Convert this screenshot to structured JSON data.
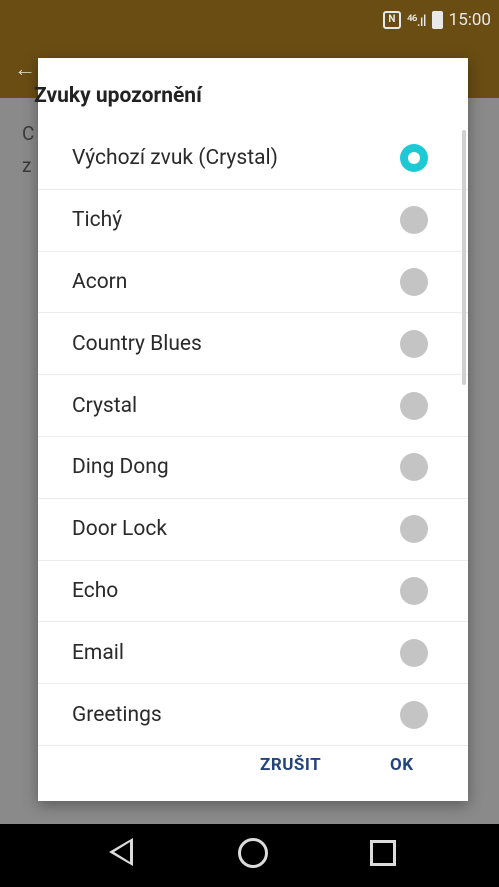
{
  "status_bar": {
    "nfc": "N",
    "signal": "⁴⁶.ıl",
    "time": "15:00"
  },
  "behind": {
    "line1": "C",
    "line2": "z"
  },
  "dialog": {
    "title": "Zvuky upozornění",
    "items": [
      {
        "label": "Výchozí zvuk (Crystal)",
        "selected": true
      },
      {
        "label": "Tichý",
        "selected": false
      },
      {
        "label": "Acorn",
        "selected": false
      },
      {
        "label": "Country Blues",
        "selected": false
      },
      {
        "label": "Crystal",
        "selected": false
      },
      {
        "label": "Ding Dong",
        "selected": false
      },
      {
        "label": "Door Lock",
        "selected": false
      },
      {
        "label": "Echo",
        "selected": false
      },
      {
        "label": "Email",
        "selected": false
      },
      {
        "label": "Greetings",
        "selected": false
      }
    ],
    "cancel_label": "ZRUŠIT",
    "ok_label": "OK"
  },
  "colors": {
    "accent": "#1dc9d4",
    "header": "#6a4d13",
    "button_text": "#23447a"
  }
}
